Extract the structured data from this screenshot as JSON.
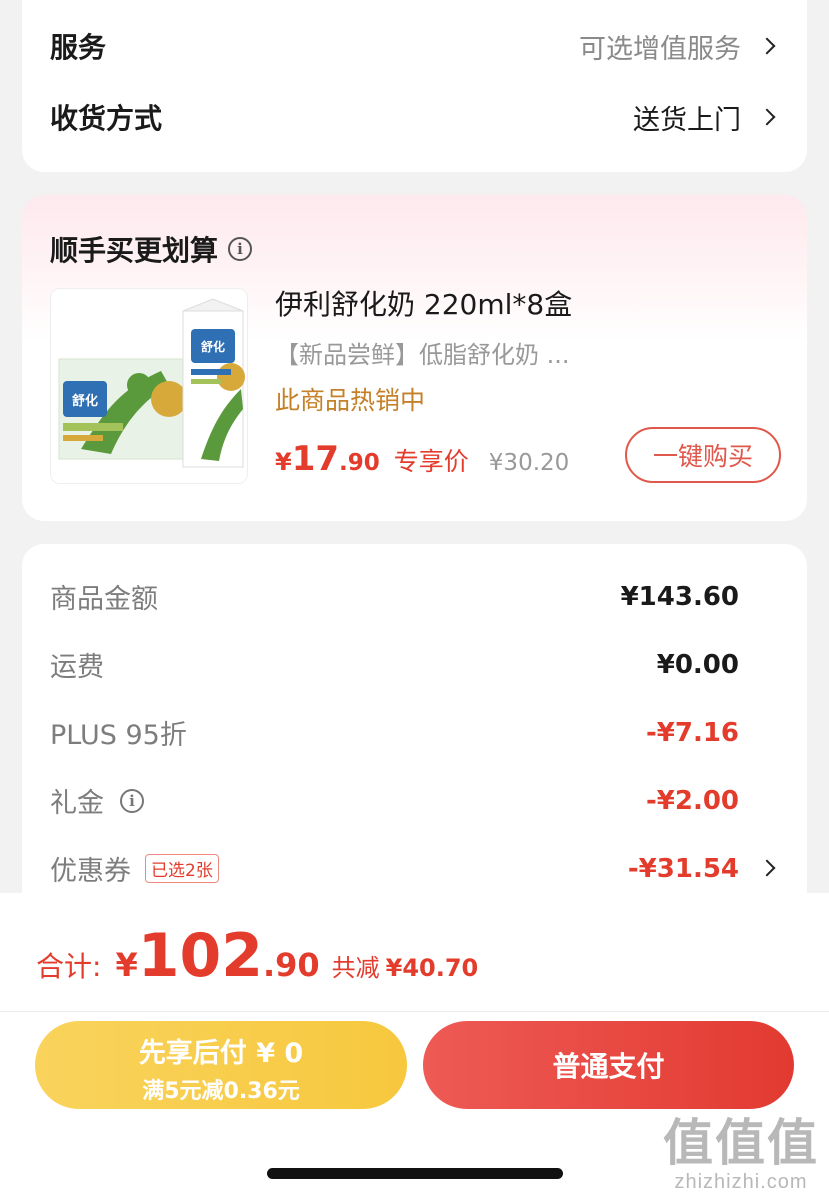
{
  "services": {
    "service_label": "服务",
    "service_value": "可选增值服务",
    "delivery_label": "收货方式",
    "delivery_value": "送货上门"
  },
  "promo": {
    "title": "顺手买更划算",
    "product_name": "伊利舒化奶 220ml*8盒",
    "product_subtitle": "【新品尝鲜】低脂舒化奶 ...",
    "hot_text": "此商品热销中",
    "price_yen": "¥",
    "price_int": "17",
    "price_dec": ".90",
    "price_tag": "专享价",
    "price_original": "¥30.20",
    "buy_button": "一键购买",
    "image_brand_text": "舒化"
  },
  "amounts": {
    "items": [
      {
        "label": "商品金额",
        "value": "¥143.60"
      },
      {
        "label": "运费",
        "value": "¥0.00"
      },
      {
        "label": "PLUS 95折",
        "value": "-¥7.16"
      },
      {
        "label": "礼金",
        "value": "-¥2.00"
      },
      {
        "label": "优惠券",
        "value": "-¥31.54"
      }
    ],
    "coupon_badge": "已选2张"
  },
  "total": {
    "label": "合计:",
    "yen": "¥",
    "int": "102",
    "dec": ".90",
    "saved_label": "共减",
    "saved_value": "¥40.70"
  },
  "actions": {
    "pay_later_line1": "先享后付 ¥ 0",
    "pay_later_line2": "满5元减0.36元",
    "pay_normal": "普通支付"
  },
  "watermark": {
    "big": "值值值",
    "small": "zhizhizhi.com"
  },
  "colors": {
    "accent_red": "#e33c2c",
    "hot_orange": "#c4812a",
    "pay_later_yellow": "#f7c83e",
    "background": "#f2f2f2"
  }
}
